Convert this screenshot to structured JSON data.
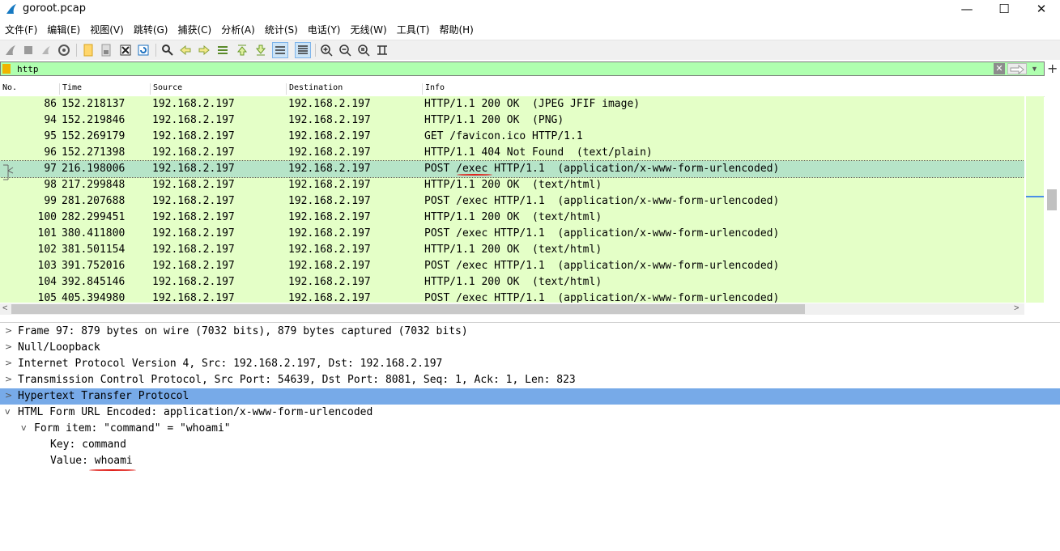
{
  "window": {
    "title": "goroot.pcap",
    "minimize": "—",
    "maximize": "☐",
    "close": "✕"
  },
  "menu": [
    "文件(F)",
    "编辑(E)",
    "视图(V)",
    "跳转(G)",
    "捕获(C)",
    "分析(A)",
    "统计(S)",
    "电话(Y)",
    "无线(W)",
    "工具(T)",
    "帮助(H)"
  ],
  "filter": {
    "value": "http",
    "clear": "✕",
    "plus": "+"
  },
  "columns": {
    "no": "No.",
    "time": "Time",
    "source": "Source",
    "destination": "Destination",
    "info": "Info"
  },
  "packets": [
    {
      "no": "86",
      "time": "152.218137",
      "src": "192.168.2.197",
      "dst": "192.168.2.197",
      "info": "HTTP/1.1 200 OK  (JPEG JFIF image)"
    },
    {
      "no": "94",
      "time": "152.219846",
      "src": "192.168.2.197",
      "dst": "192.168.2.197",
      "info": "HTTP/1.1 200 OK  (PNG)"
    },
    {
      "no": "95",
      "time": "152.269179",
      "src": "192.168.2.197",
      "dst": "192.168.2.197",
      "info": "GET /favicon.ico HTTP/1.1"
    },
    {
      "no": "96",
      "time": "152.271398",
      "src": "192.168.2.197",
      "dst": "192.168.2.197",
      "info": "HTTP/1.1 404 Not Found  (text/plain)"
    },
    {
      "no": "97",
      "time": "216.198006",
      "src": "192.168.2.197",
      "dst": "192.168.2.197",
      "info": "POST /exec HTTP/1.1  (application/x-www-form-urlencoded)",
      "selected": true
    },
    {
      "no": "98",
      "time": "217.299848",
      "src": "192.168.2.197",
      "dst": "192.168.2.197",
      "info": "HTTP/1.1 200 OK  (text/html)"
    },
    {
      "no": "99",
      "time": "281.207688",
      "src": "192.168.2.197",
      "dst": "192.168.2.197",
      "info": "POST /exec HTTP/1.1  (application/x-www-form-urlencoded)"
    },
    {
      "no": "100",
      "time": "282.299451",
      "src": "192.168.2.197",
      "dst": "192.168.2.197",
      "info": "HTTP/1.1 200 OK  (text/html)"
    },
    {
      "no": "101",
      "time": "380.411800",
      "src": "192.168.2.197",
      "dst": "192.168.2.197",
      "info": "POST /exec HTTP/1.1  (application/x-www-form-urlencoded)"
    },
    {
      "no": "102",
      "time": "381.501154",
      "src": "192.168.2.197",
      "dst": "192.168.2.197",
      "info": "HTTP/1.1 200 OK  (text/html)"
    },
    {
      "no": "103",
      "time": "391.752016",
      "src": "192.168.2.197",
      "dst": "192.168.2.197",
      "info": "POST /exec HTTP/1.1  (application/x-www-form-urlencoded)"
    },
    {
      "no": "104",
      "time": "392.845146",
      "src": "192.168.2.197",
      "dst": "192.168.2.197",
      "info": "HTTP/1.1 200 OK  (text/html)"
    },
    {
      "no": "105",
      "time": "405.394980",
      "src": "192.168.2.197",
      "dst": "192.168.2.197",
      "info": "POST /exec HTTP/1.1  (application/x-www-form-urlencoded)"
    }
  ],
  "details": [
    {
      "arrow": ">",
      "indent": 22,
      "text": "Frame 97: 879 bytes on wire (7032 bits), 879 bytes captured (7032 bits)"
    },
    {
      "arrow": ">",
      "indent": 22,
      "text": "Null/Loopback"
    },
    {
      "arrow": ">",
      "indent": 22,
      "text": "Internet Protocol Version 4, Src: 192.168.2.197, Dst: 192.168.2.197"
    },
    {
      "arrow": ">",
      "indent": 22,
      "text": "Transmission Control Protocol, Src Port: 54639, Dst Port: 8081, Seq: 1, Ack: 1, Len: 823"
    },
    {
      "arrow": ">",
      "indent": 22,
      "text": "Hypertext Transfer Protocol",
      "selected": true
    },
    {
      "arrow": "v",
      "indent": 22,
      "text": "HTML Form URL Encoded: application/x-www-form-urlencoded"
    },
    {
      "arrow": "v",
      "indent": 42,
      "text": "Form item: \"command\" = \"whoami\""
    },
    {
      "arrow": "",
      "indent": 62,
      "text": "Key: command"
    },
    {
      "arrow": "",
      "indent": 62,
      "text": "Value: whoami"
    }
  ]
}
